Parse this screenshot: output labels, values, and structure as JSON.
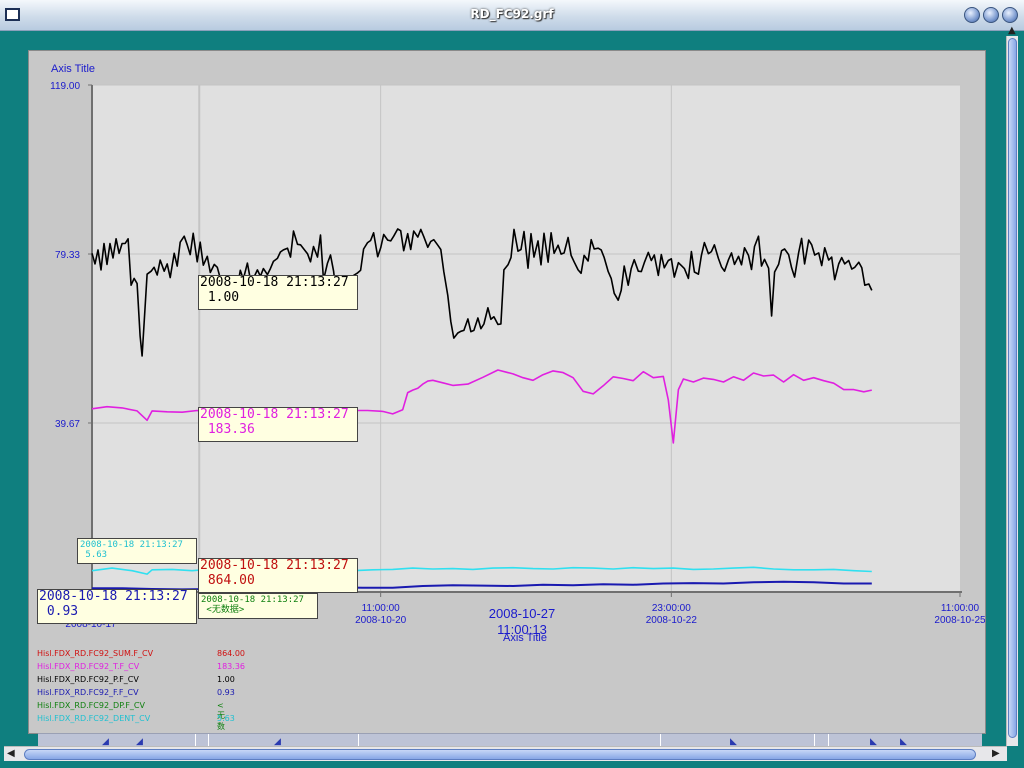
{
  "window": {
    "title": "RD_FC92.grf"
  },
  "chart_data": {
    "type": "line",
    "title": "",
    "xlabel": "Axis Title",
    "ylabel": "Axis Title",
    "ylim": [
      0,
      119
    ],
    "y_ticks": [
      "0.00",
      "39.67",
      "79.33",
      "119.00"
    ],
    "x_ticks": [
      {
        "time": "11:00:00",
        "date": "2008-10-20"
      },
      {
        "time": "23:00:00",
        "date": "2008-10-22"
      },
      {
        "time": "11:00:00",
        "date": "2008-10-25"
      }
    ],
    "x_first_tick_partial": "2008-10-17",
    "x_center_label": {
      "date": "2008-10-27",
      "time": "11:00:13"
    },
    "grid": true,
    "series": [
      {
        "name": "Hisl.FDX_RD.FC92_P.F_CV",
        "color": "#000000",
        "t": [
          0,
          3,
          6,
          9,
          12,
          15,
          18,
          21,
          24,
          27,
          30,
          33,
          36,
          39,
          42,
          45,
          48,
          50,
          55,
          59,
          62,
          65,
          68,
          72,
          75,
          78,
          82,
          85,
          88,
          92,
          95,
          98,
          101,
          105,
          108,
          111,
          115,
          118,
          122,
          125,
          128,
          131,
          135,
          138,
          141,
          145,
          148,
          151,
          155,
          158,
          161,
          165,
          168,
          171,
          175,
          178,
          181,
          185,
          188,
          191,
          195,
          198,
          201,
          205,
          208,
          211,
          215,
          218,
          221,
          225,
          228,
          231,
          235,
          238,
          241,
          245,
          248,
          251,
          255,
          258,
          261,
          265,
          268,
          271,
          275,
          278,
          281,
          285,
          288,
          291,
          295,
          298,
          301,
          305,
          308,
          311,
          315,
          318,
          321,
          325,
          328,
          331,
          335,
          338,
          341,
          345,
          348,
          351,
          355,
          358,
          361,
          365,
          368,
          371,
          375,
          378,
          381,
          385,
          388,
          391,
          395,
          398,
          401,
          405,
          408,
          411,
          415,
          418,
          421,
          425,
          428,
          431,
          435,
          438,
          441,
          445,
          448,
          451,
          455,
          458,
          461,
          465,
          468,
          471,
          475,
          478,
          481,
          485,
          488,
          491,
          495,
          498,
          501,
          505,
          508,
          511,
          515,
          518,
          521,
          525,
          528,
          531,
          535,
          538,
          541,
          545,
          548,
          551,
          555,
          558,
          561,
          565,
          568,
          571,
          575,
          578,
          581,
          585,
          588,
          591,
          595,
          598,
          601,
          605,
          608,
          611,
          615,
          618,
          621,
          625,
          628,
          631,
          635,
          638,
          641,
          645,
          648,
          651,
          655,
          658,
          661,
          665,
          668,
          671,
          675,
          678,
          681,
          685,
          688,
          691,
          695,
          698,
          701,
          705,
          708,
          711,
          715,
          718,
          721,
          725,
          728,
          731,
          735,
          738,
          741,
          745,
          748,
          751,
          755,
          758,
          761,
          765,
          768,
          771,
          775,
          778
        ],
        "values": [
          79.5,
          77.0,
          80.3,
          75.6,
          81.8,
          76.9,
          81.8,
          78.4,
          82.9,
          79.5,
          81.8,
          81.8,
          82.9,
          72.0,
          73.6,
          72.4,
          60.1,
          55.4,
          74.6,
          75.3,
          76.2,
          74.4,
          77.9,
          75.3,
          77.0,
          73.8,
          79.5,
          76.5,
          82.1,
          83.5,
          81.5,
          79.2,
          84.2,
          77.5,
          82.1,
          76.7,
          78.8,
          75.0,
          76.9,
          76.2,
          73.6,
          70.3,
          72.2,
          70.8,
          74.2,
          71.4,
          75.5,
          73.4,
          77.2,
          73.3,
          73.6,
          75.6,
          74.1,
          75.9,
          74.5,
          75.9,
          77.6,
          78.3,
          79.8,
          80.3,
          80.7,
          78.6,
          84.7,
          81.6,
          81.5,
          80.6,
          79.4,
          77.5,
          81.1,
          78.6,
          83.8,
          73.2,
          77.2,
          79.1,
          75.3,
          67.2,
          70.0,
          66.7,
          67.7,
          69.5,
          74.3,
          74.9,
          75.5,
          80.5,
          82.0,
          82.5,
          84.3,
          78.7,
          80.8,
          83.9,
          82.6,
          82.4,
          83.5,
          85.2,
          84.8,
          80.1,
          84.1,
          80.4,
          84.7,
          83.3,
          85.1,
          83.4,
          80.9,
          82.3,
          82.7,
          81.4,
          80.4,
          75.2,
          69.6,
          63.5,
          59.6,
          60.8,
          61.2,
          61.4,
          64.1,
          61.1,
          61.4,
          64.3,
          61.8,
          62.9,
          66.7,
          64.0,
          64.6,
          62.8,
          62.9,
          75.6,
          76.8,
          78.5,
          85.1,
          80.0,
          80.4,
          84.6,
          76.0,
          84.1,
          78.6,
          82.4,
          76.8,
          84.2,
          77.4,
          84.3,
          79.5,
          81.4,
          79.3,
          79.6,
          83.2,
          79.0,
          77.5,
          75.6,
          74.8,
          79.0,
          77.7,
          82.7,
          80.5,
          80.7,
          80.3,
          78.5,
          75.2,
          73.6,
          70.1,
          68.5,
          70.8,
          76.5,
          72.0,
          75.9,
          78.0,
          75.3,
          75.2,
          77.3,
          79.7,
          77.8,
          79.1,
          74.3,
          79.2,
          76.1,
          77.8,
          78.2,
          73.9,
          77.3,
          76.6,
          75.9,
          73.6,
          79.9,
          75.1,
          74.6,
          79.0,
          82.0,
          79.4,
          79.9,
          81.5,
          78.3,
          76.3,
          75.3,
          78.0,
          79.6,
          76.9,
          78.8,
          76.8,
          80.8,
          79.0,
          75.7,
          81.1,
          83.5,
          76.5,
          78.1,
          76.0,
          64.8,
          75.1,
          76.9,
          80.1,
          80.5,
          79.2,
          76.1,
          73.9,
          79.6,
          83.0,
          77.0,
          82.6,
          81.5,
          79.1,
          79.6,
          76.6,
          80.8,
          77.9,
          78.6,
          73.3,
          77.0,
          78.5,
          77.0,
          77.8,
          75.8,
          76.2,
          77.4,
          76.1,
          72.0,
          72.3,
          70.8,
          72.9,
          75.5,
          75.4,
          72.9
        ]
      },
      {
        "name": "Hisl.FDX_RD.FC92_T.F_CV",
        "color": "#e020e0",
        "values_note": "approx",
        "t": [
          0,
          15,
          30,
          45,
          55,
          60,
          75,
          90,
          105,
          120,
          135,
          150,
          165,
          180,
          200,
          215,
          230,
          245,
          260,
          275,
          290,
          300,
          310,
          315,
          320,
          325,
          330,
          335,
          340,
          350,
          360,
          375,
          390,
          405,
          420,
          430,
          440,
          450,
          460,
          470,
          480,
          490,
          500,
          510,
          520,
          530,
          540,
          550,
          560,
          570,
          575,
          580,
          585,
          590,
          600,
          610,
          620,
          630,
          640,
          650,
          660,
          670,
          680,
          690,
          700,
          710,
          720,
          730,
          740,
          750,
          760,
          770,
          778
        ],
        "values": [
          43.0,
          43.5,
          43.2,
          42.5,
          40.3,
          42.5,
          42.3,
          42.2,
          42.6,
          42.2,
          42.1,
          42.5,
          42.2,
          42.5,
          42.7,
          41.9,
          41.8,
          42.4,
          42.6,
          42.6,
          42.4,
          41.8,
          42.8,
          46.8,
          47.4,
          47.8,
          48.8,
          49.5,
          49.7,
          49.1,
          48.5,
          48.8,
          50.4,
          52.1,
          51.2,
          50.3,
          49.7,
          51.0,
          51.9,
          51.5,
          50.3,
          47.1,
          46.5,
          48.4,
          50.5,
          50.1,
          49.6,
          51.7,
          50.3,
          50.6,
          45.1,
          35.0,
          47.5,
          50.0,
          49.3,
          50.2,
          49.9,
          49.3,
          50.5,
          49.7,
          51.4,
          50.7,
          50.9,
          49.3,
          51.0,
          49.7,
          50.3,
          49.6,
          49.0,
          47.5,
          47.5,
          47.0,
          47.4
        ]
      },
      {
        "name": "Hisl.FDX_RD.FC92_DENT_CV",
        "color": "#30e0f0",
        "t": [
          0,
          20,
          40,
          55,
          60,
          80,
          100,
          120,
          140,
          160,
          180,
          200,
          220,
          240,
          260,
          280,
          300,
          320,
          340,
          360,
          380,
          400,
          420,
          440,
          460,
          480,
          500,
          520,
          540,
          560,
          580,
          600,
          620,
          640,
          660,
          680,
          700,
          720,
          740,
          760,
          778
        ],
        "values": [
          5.0,
          5.6,
          5.0,
          4.2,
          5.2,
          5.3,
          5.0,
          5.4,
          5.1,
          5.3,
          5.1,
          5.0,
          5.2,
          5.1,
          5.0,
          5.2,
          5.3,
          5.6,
          5.4,
          5.5,
          5.3,
          5.6,
          5.7,
          5.5,
          5.4,
          5.7,
          5.6,
          5.4,
          5.7,
          5.5,
          5.6,
          5.3,
          5.4,
          5.6,
          5.8,
          5.4,
          5.2,
          5.2,
          5.3,
          5.0,
          4.8
        ]
      },
      {
        "name": "Hisl.FDX_RD.FC92_F.F_CV",
        "color": "#1a1ab0",
        "t": [
          0,
          30,
          60,
          90,
          120,
          150,
          180,
          210,
          240,
          270,
          300,
          330,
          360,
          390,
          420,
          450,
          480,
          510,
          540,
          570,
          600,
          630,
          660,
          690,
          720,
          750,
          778
        ],
        "values": [
          0.9,
          0.9,
          0.7,
          0.6,
          0.7,
          0.5,
          0.8,
          1.0,
          1.1,
          1.0,
          1.0,
          1.4,
          1.6,
          1.5,
          1.4,
          1.7,
          1.6,
          1.8,
          1.7,
          2.0,
          2.1,
          2.0,
          2.3,
          2.4,
          2.3,
          2.0,
          2.0
        ]
      }
    ]
  },
  "tooltips": [
    {
      "time": "2008-10-18 21:13:27",
      "value": "1.00",
      "color": "#000000"
    },
    {
      "time": "2008-10-18 21:13:27",
      "value": "183.36",
      "color": "#e020e0"
    },
    {
      "time": "2008-10-18 21:13:27",
      "value": "864.00",
      "color": "#c01010"
    },
    {
      "time": "2008-10-18 21:13:27",
      "value": "0.93",
      "color": "#1a1ab0"
    },
    {
      "time": "2008-10-18 21:13:27",
      "value": "<无数据>",
      "color": "#108010"
    },
    {
      "time": "2008-10-18 21:13:27",
      "value": "5.63",
      "color": "#20c0d0"
    }
  ],
  "legend": [
    {
      "name": "Hisl.FDX_RD.FC92_SUM.F_CV",
      "value": "864.00",
      "color": "#d01010"
    },
    {
      "name": "Hisl.FDX_RD.FC92_T.F_CV",
      "value": "183.36",
      "color": "#e020e0"
    },
    {
      "name": "Hisl.FDX_RD.FC92_P.F_CV",
      "value": "1.00",
      "color": "#000000"
    },
    {
      "name": "Hisl.FDX_RD.FC92_F.F_CV",
      "value": "0.93",
      "color": "#1a1ab0"
    },
    {
      "name": "Hisl.FDX_RD.FC92_DP.F_CV",
      "value": "<无数据>",
      "color": "#108010"
    },
    {
      "name": "Hisl.FDX_RD.FC92_DENT_CV",
      "value": "5.63",
      "color": "#20c0d0"
    }
  ]
}
